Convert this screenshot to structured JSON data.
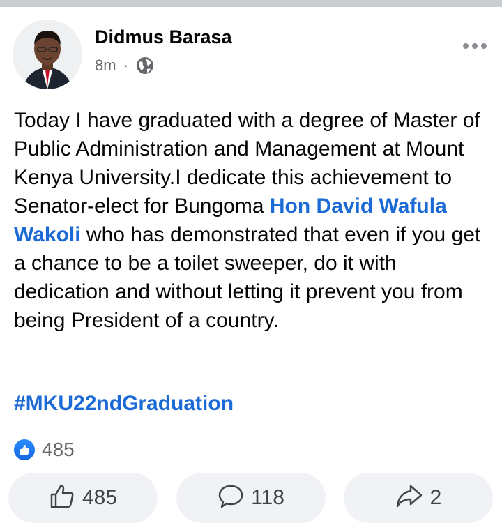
{
  "author": {
    "name": "Didmus Barasa"
  },
  "meta": {
    "time": "8m",
    "separator": "·",
    "audience_icon": "globe-icon"
  },
  "post": {
    "text_before": "Today I have graduated with a degree of Master of Public Administration and Management at Mount Kenya University.I dedicate this achievement to Senator-elect for Bungoma ",
    "mention": "Hon David Wafula Wakoli",
    "text_after": " who has demonstrated that even if you get a chance to be a toilet sweeper, do it with dedication and without letting it prevent you from being President of a country.",
    "hashtag": "#MKU22ndGraduation"
  },
  "reactions": {
    "count": "485",
    "icon": "like-icon"
  },
  "actions": {
    "like_count": "485",
    "comment_count": "118",
    "share_count": "2"
  },
  "colors": {
    "link": "#1b6ad6",
    "secondary_text": "#65676b",
    "button_bg": "#f0f2f5"
  }
}
